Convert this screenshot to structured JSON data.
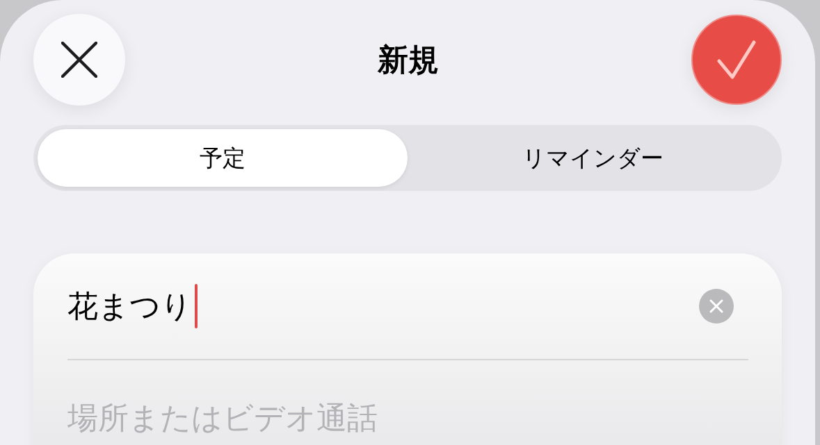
{
  "header": {
    "title": "新規"
  },
  "segments": [
    {
      "label": "予定",
      "selected": true
    },
    {
      "label": "リマインダー",
      "selected": false
    }
  ],
  "title_field": {
    "value": "花まつり",
    "focused": true
  },
  "location_field": {
    "placeholder": "場所またはビデオ通話"
  }
}
